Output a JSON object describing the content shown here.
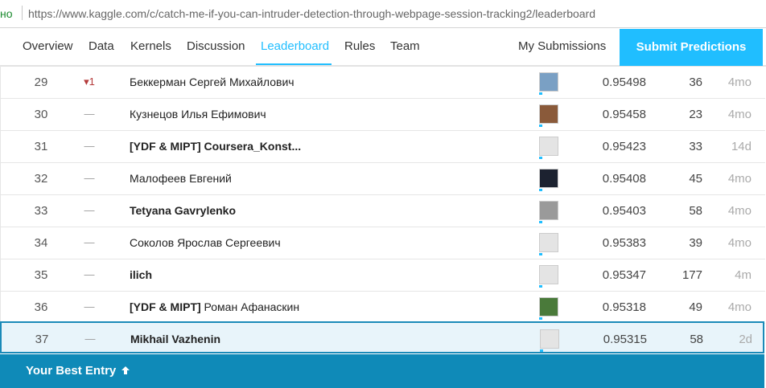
{
  "browser": {
    "secure_label": "но",
    "url": "https://www.kaggle.com/c/catch-me-if-you-can-intruder-detection-through-webpage-session-tracking2/leaderboard"
  },
  "nav": {
    "tabs": [
      {
        "label": "Overview"
      },
      {
        "label": "Data"
      },
      {
        "label": "Kernels"
      },
      {
        "label": "Discussion"
      },
      {
        "label": "Leaderboard"
      },
      {
        "label": "Rules"
      },
      {
        "label": "Team"
      }
    ],
    "my_submissions": "My Submissions",
    "submit": "Submit Predictions",
    "accent": "#20beff"
  },
  "leaderboard": {
    "rows": [
      {
        "rank": "29",
        "change": "▾1",
        "name": "Беккерман Сергей Михайлович",
        "bold": false,
        "score": "0.95498",
        "entries": "36",
        "last": "4mo"
      },
      {
        "rank": "30",
        "change": "—",
        "name": "Кузнецов Илья Ефимович",
        "bold": false,
        "score": "0.95458",
        "entries": "23",
        "last": "4mo"
      },
      {
        "rank": "31",
        "change": "—",
        "name": "[YDF & MIPT] Coursera_Konst...",
        "bold": true,
        "score": "0.95423",
        "entries": "33",
        "last": "14d"
      },
      {
        "rank": "32",
        "change": "—",
        "name": "Малофеев Евгений",
        "bold": false,
        "score": "0.95408",
        "entries": "45",
        "last": "4mo"
      },
      {
        "rank": "33",
        "change": "—",
        "name": "Tetyana Gavrylenko",
        "bold": true,
        "score": "0.95403",
        "entries": "58",
        "last": "4mo"
      },
      {
        "rank": "34",
        "change": "—",
        "name": "Соколов Ярослав Сергеевич",
        "bold": false,
        "score": "0.95383",
        "entries": "39",
        "last": "4mo"
      },
      {
        "rank": "35",
        "change": "—",
        "name": "ilich",
        "bold": true,
        "score": "0.95347",
        "entries": "177",
        "last": "4m"
      },
      {
        "rank": "36",
        "change": "—",
        "name_prefix": "[YDF & MIPT]",
        "name": " Роман Афанаскин",
        "bold": false,
        "score": "0.95318",
        "entries": "49",
        "last": "4mo"
      },
      {
        "rank": "37",
        "change": "—",
        "name": "Mikhail Vazhenin",
        "bold": true,
        "score": "0.95315",
        "entries": "58",
        "last": "2d"
      }
    ]
  },
  "best_entry": {
    "label": "Your Best Entry",
    "icon": "arrow-up-icon"
  }
}
